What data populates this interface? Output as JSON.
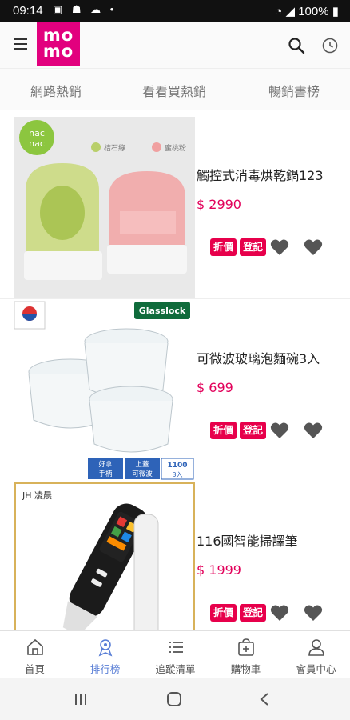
{
  "status_bar": {
    "time": "09:14",
    "battery": "100%"
  },
  "header": {
    "logo_text_top": "mo",
    "logo_text_bottom": "mo"
  },
  "tabs": [
    {
      "label": "網路熱銷"
    },
    {
      "label": "看看買熱銷"
    },
    {
      "label": "暢銷書榜"
    }
  ],
  "products": [
    {
      "name": "觸控式消毒烘乾鍋123",
      "price": "$ 2990",
      "tags": [
        "折價",
        "登記"
      ],
      "image_labels": {
        "brand_top": "nac",
        "brand_bottom": "nac",
        "variant_a": "桔石綠",
        "variant_b": "蜜桃粉"
      }
    },
    {
      "name": "可微波玻璃泡麵碗3入",
      "price": "$ 699",
      "tags": [
        "折價",
        "登記"
      ],
      "image_labels": {
        "brand": "Glasslock",
        "badge1_a": "好拿",
        "badge1_b": "手柄",
        "badge2_a": "上蓋",
        "badge2_b": "可微波",
        "badge3_a": "1100",
        "badge3_b": "3入"
      }
    },
    {
      "name": "116國智能掃譯筆",
      "price": "$ 1999",
      "tags": [
        "折價",
        "登記"
      ],
      "image_labels": {
        "brand": "JH 凌晨"
      }
    }
  ],
  "bottom_nav": [
    {
      "label": "首頁",
      "icon": "home-icon"
    },
    {
      "label": "排行榜",
      "icon": "ranking-icon"
    },
    {
      "label": "追蹤清單",
      "icon": "list-icon"
    },
    {
      "label": "購物車",
      "icon": "cart-icon"
    },
    {
      "label": "會員中心",
      "icon": "member-icon"
    }
  ],
  "colors": {
    "brand": "#e2007e",
    "price": "#e2005a",
    "tag": "#e7004b",
    "active_nav": "#5a7fd6"
  }
}
